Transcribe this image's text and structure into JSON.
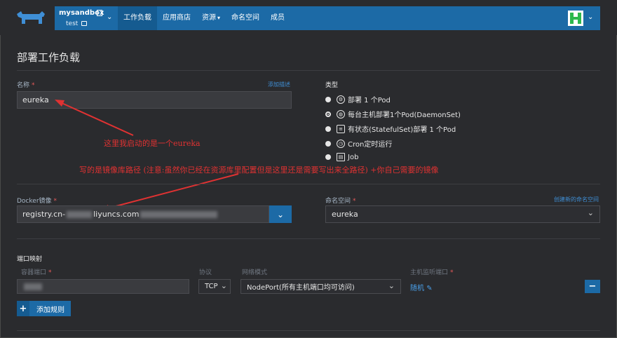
{
  "header": {
    "project": "mysandbox",
    "namespace": "test",
    "nav": [
      "工作负载",
      "应用商店",
      "资源",
      "命名空间",
      "成员"
    ],
    "resource_caret": "▾",
    "env_chevron": "⌄",
    "user_chevron": "⌄"
  },
  "page": {
    "title": "部署工作负载"
  },
  "form": {
    "name_label": "名称",
    "required_mark": "*",
    "add_desc": "添加描述",
    "name_value": "eureka",
    "type_label": "类型",
    "types": [
      "部署 1 个Pod",
      "每台主机部署1个Pod(DaemonSet)",
      "有状态(StatefulSet)部署 1 个Pod",
      "Cron定时运行",
      "Job"
    ],
    "selected_type_index": 1,
    "docker_label": "Docker镜像",
    "docker_value_prefix": "registry.cn-",
    "docker_value_mid": "liyuncs.com",
    "namespace_label": "命名空间",
    "create_namespace": "创建新的命名空间",
    "namespace_value": "eureka",
    "port_mapping_label": "端口映射",
    "container_port_label": "容器端口",
    "protocol_label": "协议",
    "network_mode_label": "网络模式",
    "host_port_label": "主机监听端口",
    "protocol_value": "TCP",
    "network_mode_value": "NodePort(所有主机端口均可访问)",
    "host_port_value": "随机",
    "add_rule": "添加规则",
    "plus_symbol": "+",
    "minus_symbol": "−"
  },
  "annotations": {
    "name_note": "这里我启动的是一个eureka",
    "image_note": "写的是镜像库路径 (注意:虽然你已经在资源库里配置但是这里还是需要写出来全路径) +你自己需要的镜像"
  },
  "colors": {
    "accent": "#1c6aa6",
    "annotation": "#e03232",
    "background": "#2a2b2e"
  }
}
